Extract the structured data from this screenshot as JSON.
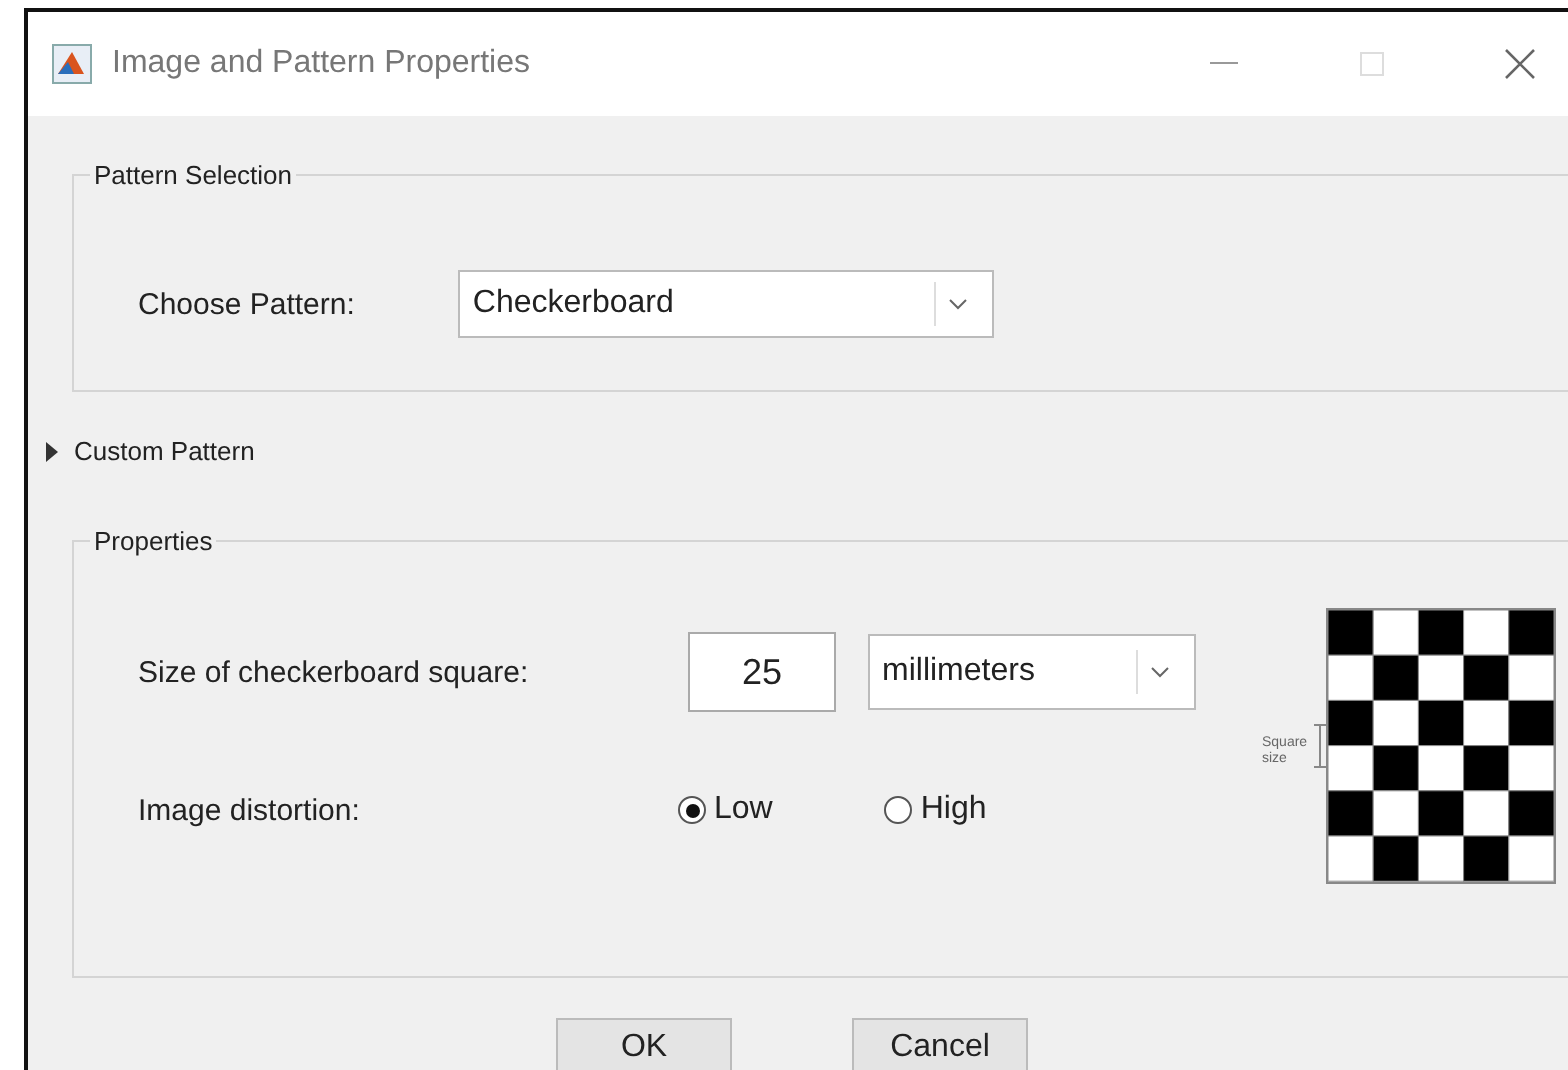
{
  "window": {
    "title": "Image and Pattern Properties"
  },
  "pattern_selection": {
    "title": "Pattern Selection",
    "label": "Choose Pattern:",
    "value": "Checkerboard"
  },
  "custom_pattern": {
    "label": "Custom Pattern",
    "expanded": false
  },
  "properties": {
    "title": "Properties",
    "size_label": "Size of checkerboard square:",
    "size_value": "25",
    "unit": "millimeters",
    "preview_label": "Square size",
    "distortion_label": "Image distortion:",
    "distortion_options": [
      {
        "label": "Low",
        "selected": true
      },
      {
        "label": "High",
        "selected": false
      }
    ]
  },
  "buttons": [
    "OK",
    "Cancel"
  ]
}
